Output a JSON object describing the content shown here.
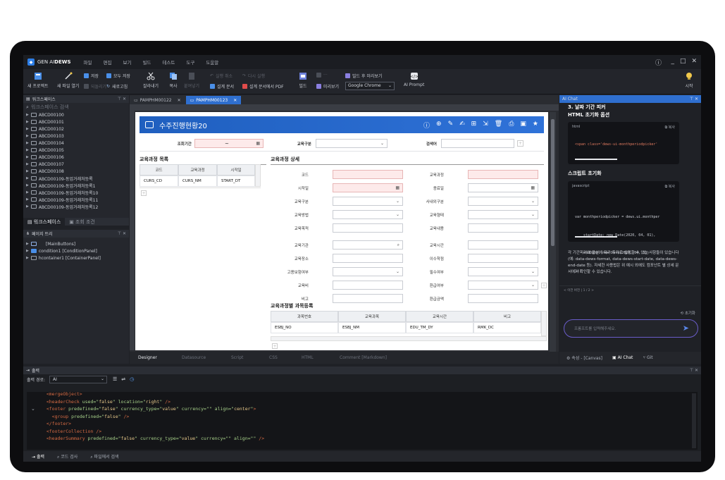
{
  "app": {
    "logo_text": "GEN AI",
    "logo_bold": "DEWS"
  },
  "menu": [
    "파일",
    "편집",
    "보기",
    "빌드",
    "테스트",
    "도구",
    "도움말"
  ],
  "toolbar": {
    "new_project": "새 프로젝트",
    "new_window": "새 파일 열기",
    "save": "저장",
    "save_all": "모두 저장",
    "revert": "되돌리기",
    "refresh": "새로고침",
    "cut": "잘라내기",
    "copy": "복사",
    "paste": "붙여넣기",
    "undo": "실행 취소",
    "redo": "다시 실행",
    "design_doc": "설계 문서",
    "design_doc_pdf": "설계 문서에서 PDF",
    "build": "빌드",
    "preview": "미리보기",
    "build_preview": "빌드 후 미리보기",
    "browser_value": "Google Chrome",
    "ai_prompt": "AI Prompt",
    "start": "시작"
  },
  "workspace": {
    "title": "워크스페이스",
    "search_placeholder": "워크스페이스 검색",
    "items": [
      "ABCD00100",
      "ABCD00101",
      "ABCD00102",
      "ABCD00103",
      "ABCD00104",
      "ABCD00105",
      "ABCD00106",
      "ABCD00107",
      "ABCD00108",
      "ABCD00109-동업거래처등록",
      "ABCD00109-동업거래처등록1",
      "ABCD00109-동업거래처등록10",
      "ABCD00109-동업거래처등록11",
      "ABCD00109-동업거래처등록12"
    ],
    "tab_workspace": "워크스페이스",
    "tab_search": "조회 조건"
  },
  "page_tree": {
    "title": "페이지 트리",
    "items": [
      "[MainButtons]",
      "condition1 [ConditionPanel]",
      "hcontainer1 [ContainerPanel]"
    ]
  },
  "editor": {
    "tabs": [
      "PAMPHM00122",
      "PAMPHM00123"
    ],
    "bottom_tabs": [
      "Designer",
      "Datasource",
      "Script",
      "CSS",
      "HTML",
      "Comment [Markdown]"
    ]
  },
  "form": {
    "title": "수주진행현황20",
    "cond_period": "조회기간",
    "cond_period_sep": "~",
    "cond_type": "교육구분",
    "cond_keyword": "검색어",
    "list_title": "교육과정 목록",
    "list_headers": [
      "코드",
      "교육과정",
      "시작일"
    ],
    "list_row": [
      "CURS_CD",
      "CURS_NM",
      "START_DT"
    ],
    "detail_title": "교육과정 상세",
    "detail_left": [
      "코드",
      "시작일",
      "교육구분",
      "교육방법",
      "교육목적",
      "교육기관",
      "교육장소",
      "고용보험여부",
      "교육비",
      "비고"
    ],
    "detail_right": [
      "교육과정",
      "종료일",
      "사내외구분",
      "교육형태",
      "교육내용",
      "교육시간",
      "이수학점",
      "필수여부",
      "환급여부",
      "환급금액"
    ],
    "subject_title": "교육과정별 과목등록",
    "subject_headers": [
      "과목번호",
      "교육과목",
      "교육시간",
      "비고"
    ],
    "subject_row": [
      "ESBJ_NO",
      "ESBJ_NM",
      "EDU_TM_DY",
      "RMK_DC"
    ]
  },
  "ai_chat": {
    "title": "AI Chat",
    "heading": "3. 날짜 기간 피커",
    "sub1": "HTML 초기화 옵션",
    "code1_lang": "html",
    "code1_copy": "복사",
    "code1_body": "<span class='dews-ui-monthperiodpicker'",
    "sub2": "스크립트 초기화",
    "code2_lang": "javascript",
    "code2_copy": "복사",
    "code2_lines": [
      "var monthperiodpicker = dews.ui.monthper",
      "    startDate: new Date(2020, 04, 01),",
      "    endDate: new Date(2020, 04, 31)",
      "});"
    ],
    "desc": "각 기간피커의 옵션에 따라 추가로 설정할 수 있는 사항들이 있습니다(예: data-dews-format, data-dews-start-date, data-dews-end-date 등). 자세한 사용법은 위 예시 외에도 컴포넌트 별 상세 문서에서 확인할 수 있습니다.",
    "meta": "< 이전 버전 | 1 / 2 >",
    "reset": "초기화",
    "input_placeholder": "프롬프트를 입력해주세요.",
    "bottom_tabs": [
      "속성 - [Canvas]",
      "AI Chat",
      "Git"
    ]
  },
  "output": {
    "title": "출력",
    "source_label": "출력 경로:",
    "source_value": "AI",
    "lines": [
      {
        "indent": 1,
        "tag": "mergeObject",
        "attrs": [],
        "close": ">"
      },
      {
        "indent": 1,
        "tag": "headerCheck",
        "attrs": [
          [
            "used",
            "false"
          ],
          [
            "location",
            "right"
          ]
        ],
        "close": " />"
      },
      {
        "indent": 1,
        "tag": "footer",
        "attrs": [
          [
            "predefined",
            "false"
          ],
          [
            "currency_type",
            "value"
          ],
          [
            "currency",
            ""
          ],
          [
            "align",
            "center"
          ]
        ],
        "close": ">"
      },
      {
        "indent": 2,
        "tag": "group",
        "attrs": [
          [
            "predefined",
            "false"
          ]
        ],
        "close": " />"
      },
      {
        "indent": 1,
        "tag": "/footer",
        "attrs": [],
        "close": ">"
      },
      {
        "indent": 1,
        "tag": "footerCollection",
        "attrs": [],
        "close": " />"
      },
      {
        "indent": 1,
        "tag": "headerSummary",
        "attrs": [
          [
            "predefined",
            "false"
          ],
          [
            "currency_type",
            "value"
          ],
          [
            "currency",
            ""
          ],
          [
            "align",
            ""
          ]
        ],
        "close": " />"
      }
    ],
    "bottom_tabs": [
      "출력",
      "코드 검사",
      "파일에서 검색"
    ]
  }
}
